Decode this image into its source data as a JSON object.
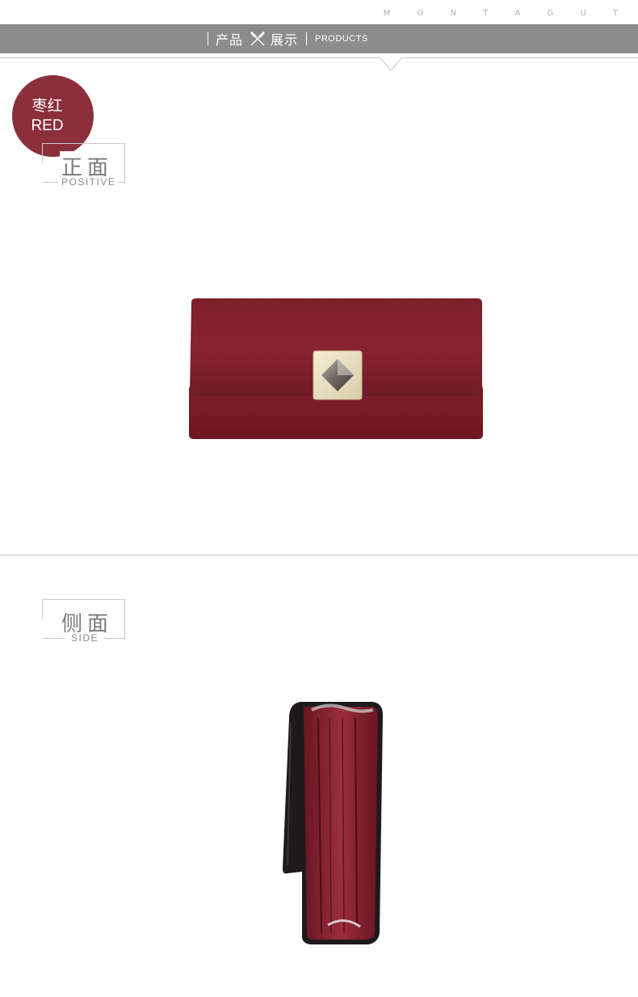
{
  "header": {
    "brand": "M O N T A G U T",
    "title_cn_1": "产品",
    "title_cn_2": "展示",
    "title_en": "PRODUCTS",
    "banner_color": "#8c8c8d"
  },
  "color_badge": {
    "name_cn": "枣红",
    "name_en": "RED",
    "color": "#8b2f3a"
  },
  "sections": {
    "front": {
      "title_cn": "正面",
      "title_en": "POSITIVE"
    },
    "side": {
      "title_cn": "侧面",
      "title_en": "SIDE"
    }
  },
  "icons": {
    "banner_mark": "x-mark-icon"
  }
}
